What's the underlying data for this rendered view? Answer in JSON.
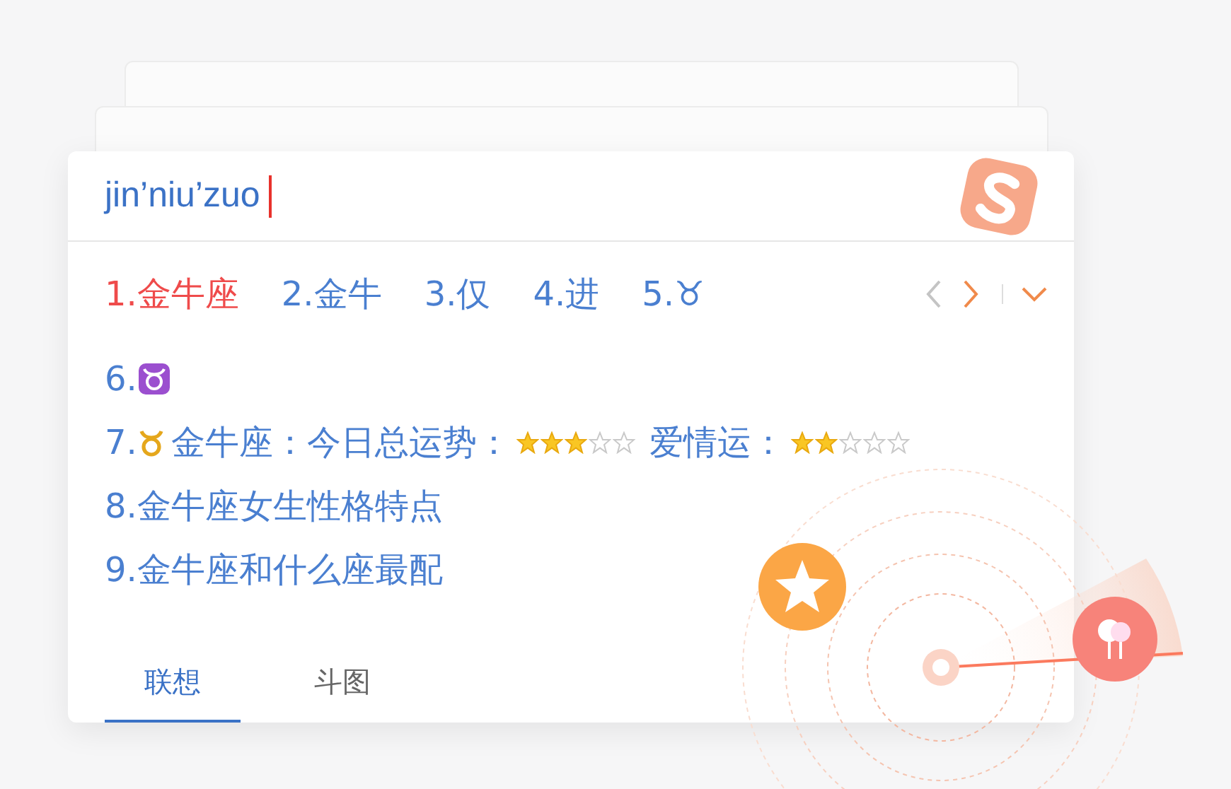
{
  "input": {
    "value": "jin’niu’zuo"
  },
  "candidates": [
    {
      "index": "1.",
      "text": "金牛座",
      "selected": true
    },
    {
      "index": "2.",
      "text": "金牛",
      "selected": false
    },
    {
      "index": "3.",
      "text": "仅",
      "selected": false
    },
    {
      "index": "4.",
      "text": "进",
      "selected": false
    },
    {
      "index": "5.",
      "text": "♉",
      "selected": false
    }
  ],
  "paging": {
    "prev": {
      "disabled": true
    },
    "next": {
      "disabled": false
    }
  },
  "more": [
    {
      "kind": "emoji",
      "index": "6."
    },
    {
      "kind": "fortune",
      "index": "7.",
      "sign": "金牛座：",
      "fields": [
        {
          "label": "今日总运势：",
          "stars": 3
        },
        {
          "label": "爱情运：",
          "stars": 2
        }
      ]
    },
    {
      "kind": "text",
      "index": "8.",
      "text": "金牛座女生性格特点"
    },
    {
      "kind": "text",
      "index": "9.",
      "text": "金牛座和什么座最配"
    }
  ],
  "tabs": [
    {
      "label": "联想",
      "selected": true
    },
    {
      "label": "斗图",
      "selected": false
    }
  ]
}
